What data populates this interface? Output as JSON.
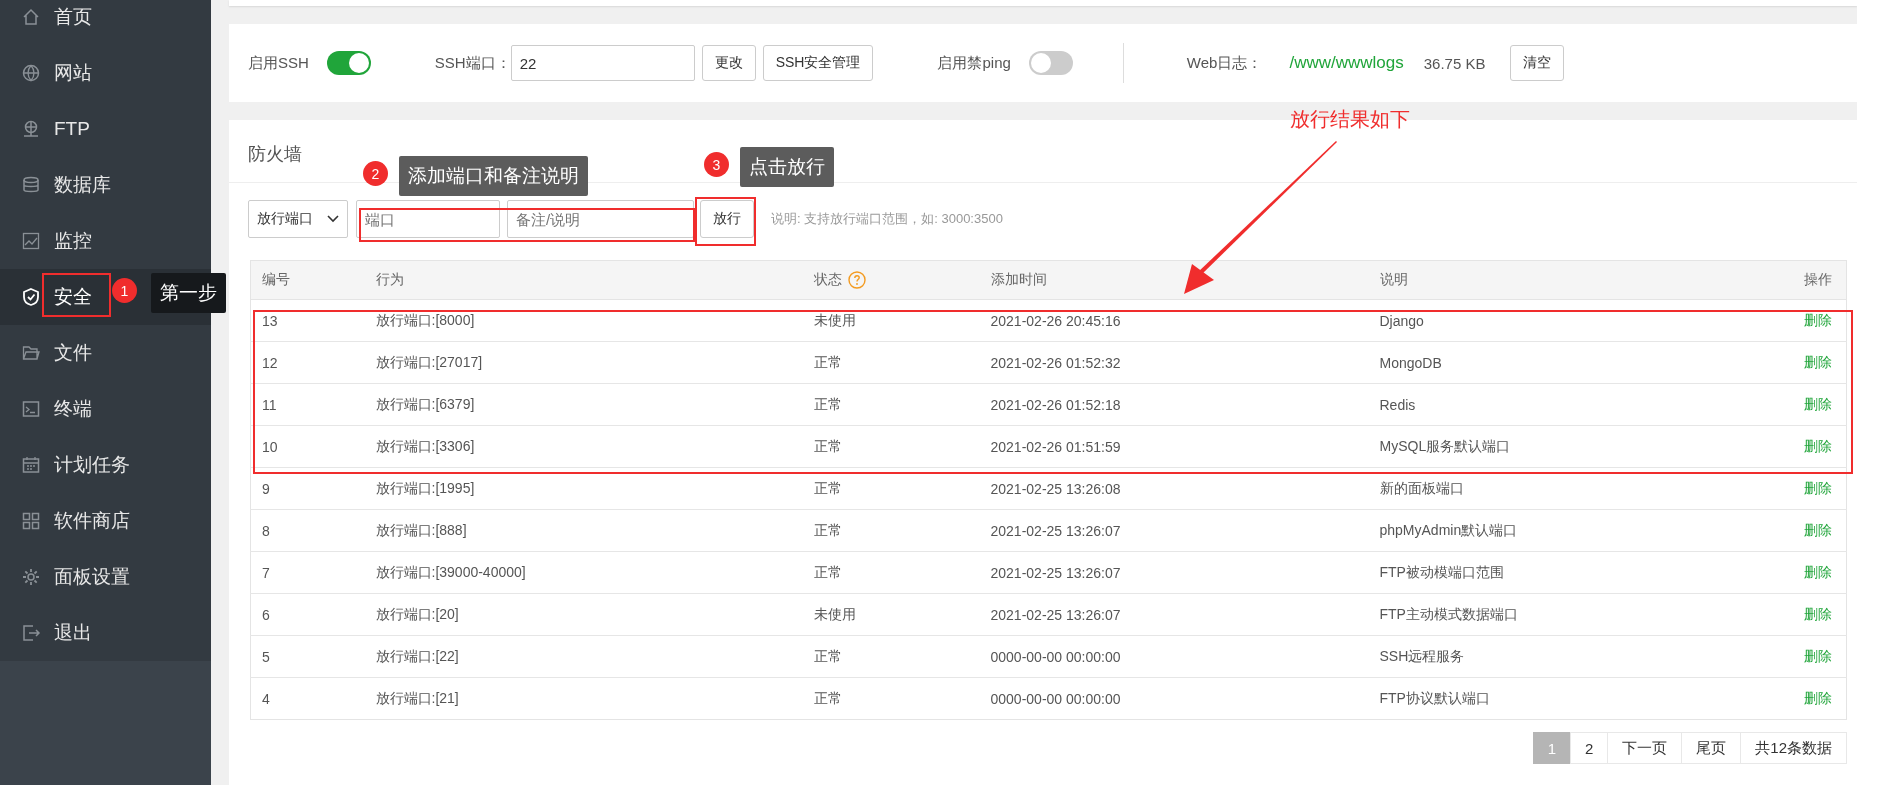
{
  "sidebar": {
    "items": [
      {
        "label": "首页",
        "selected": false
      },
      {
        "label": "网站",
        "selected": false
      },
      {
        "label": "FTP",
        "selected": false
      },
      {
        "label": "数据库",
        "selected": false
      },
      {
        "label": "监控",
        "selected": false
      },
      {
        "label": "安全",
        "selected": true
      },
      {
        "label": "文件",
        "selected": false
      },
      {
        "label": "终端",
        "selected": false
      },
      {
        "label": "计划任务",
        "selected": false
      },
      {
        "label": "软件商店",
        "selected": false
      },
      {
        "label": "面板设置",
        "selected": false
      },
      {
        "label": "退出",
        "selected": false
      }
    ]
  },
  "ssh_panel": {
    "ssh_label": "启用SSH",
    "ssh_toggle": {
      "on": true
    },
    "port_label": "SSH端口：",
    "port_value": "22",
    "change_button": "更改",
    "manage_button": "SSH安全管理",
    "ping_label": "启用禁ping",
    "ping_toggle": {
      "on": false
    },
    "log_label": "Web日志：",
    "log_path": "/www/wwwlogs",
    "log_size": "36.75 KB",
    "clear_button": "清空"
  },
  "firewall": {
    "title": "防火墙",
    "rule_select": "放行端口",
    "port_placeholder": "端口",
    "note_placeholder": "备注/说明",
    "submit_button": "放行",
    "hint": "说明: 支持放行端口范围，如: 3000:3500",
    "table": {
      "columns": [
        "编号",
        "行为",
        "状态",
        "添加时间",
        "说明",
        "操作"
      ],
      "rows": [
        {
          "id": "13",
          "action": "放行端口:[8000]",
          "status": "未使用",
          "time": "2021-02-26 20:45:16",
          "note": "Django",
          "op": "删除"
        },
        {
          "id": "12",
          "action": "放行端口:[27017]",
          "status": "正常",
          "time": "2021-02-26 01:52:32",
          "note": "MongoDB",
          "op": "删除"
        },
        {
          "id": "11",
          "action": "放行端口:[6379]",
          "status": "正常",
          "time": "2021-02-26 01:52:18",
          "note": "Redis",
          "op": "删除"
        },
        {
          "id": "10",
          "action": "放行端口:[3306]",
          "status": "正常",
          "time": "2021-02-26 01:51:59",
          "note": "MySQL服务默认端口",
          "op": "删除"
        },
        {
          "id": "9",
          "action": "放行端口:[1995]",
          "status": "正常",
          "time": "2021-02-25 13:26:08",
          "note": "新的面板端口",
          "op": "删除"
        },
        {
          "id": "8",
          "action": "放行端口:[888]",
          "status": "正常",
          "time": "2021-02-25 13:26:07",
          "note": "phpMyAdmin默认端口",
          "op": "删除"
        },
        {
          "id": "7",
          "action": "放行端口:[39000-40000]",
          "status": "正常",
          "time": "2021-02-25 13:26:07",
          "note": "FTP被动模端口范围",
          "op": "删除"
        },
        {
          "id": "6",
          "action": "放行端口:[20]",
          "status": "未使用",
          "time": "2021-02-25 13:26:07",
          "note": "FTP主动模式数据端口",
          "op": "删除"
        },
        {
          "id": "5",
          "action": "放行端口:[22]",
          "status": "正常",
          "time": "0000-00-00 00:00:00",
          "note": "SSH远程服务",
          "op": "删除"
        },
        {
          "id": "4",
          "action": "放行端口:[21]",
          "status": "正常",
          "time": "0000-00-00 00:00:00",
          "note": "FTP协议默认端口",
          "op": "删除"
        }
      ]
    },
    "pagination": {
      "pages": [
        {
          "label": "1",
          "selected": true
        },
        {
          "label": "2",
          "selected": false
        }
      ],
      "next": "下一页",
      "last": "尾页",
      "total": "共12条数据"
    }
  },
  "annotations": {
    "steps": [
      {
        "number": "1",
        "text": "第一步"
      },
      {
        "number": "2",
        "text": "添加端口和备注说明"
      },
      {
        "number": "3",
        "text": "点击放行"
      }
    ],
    "result_note": "放行结果如下"
  }
}
